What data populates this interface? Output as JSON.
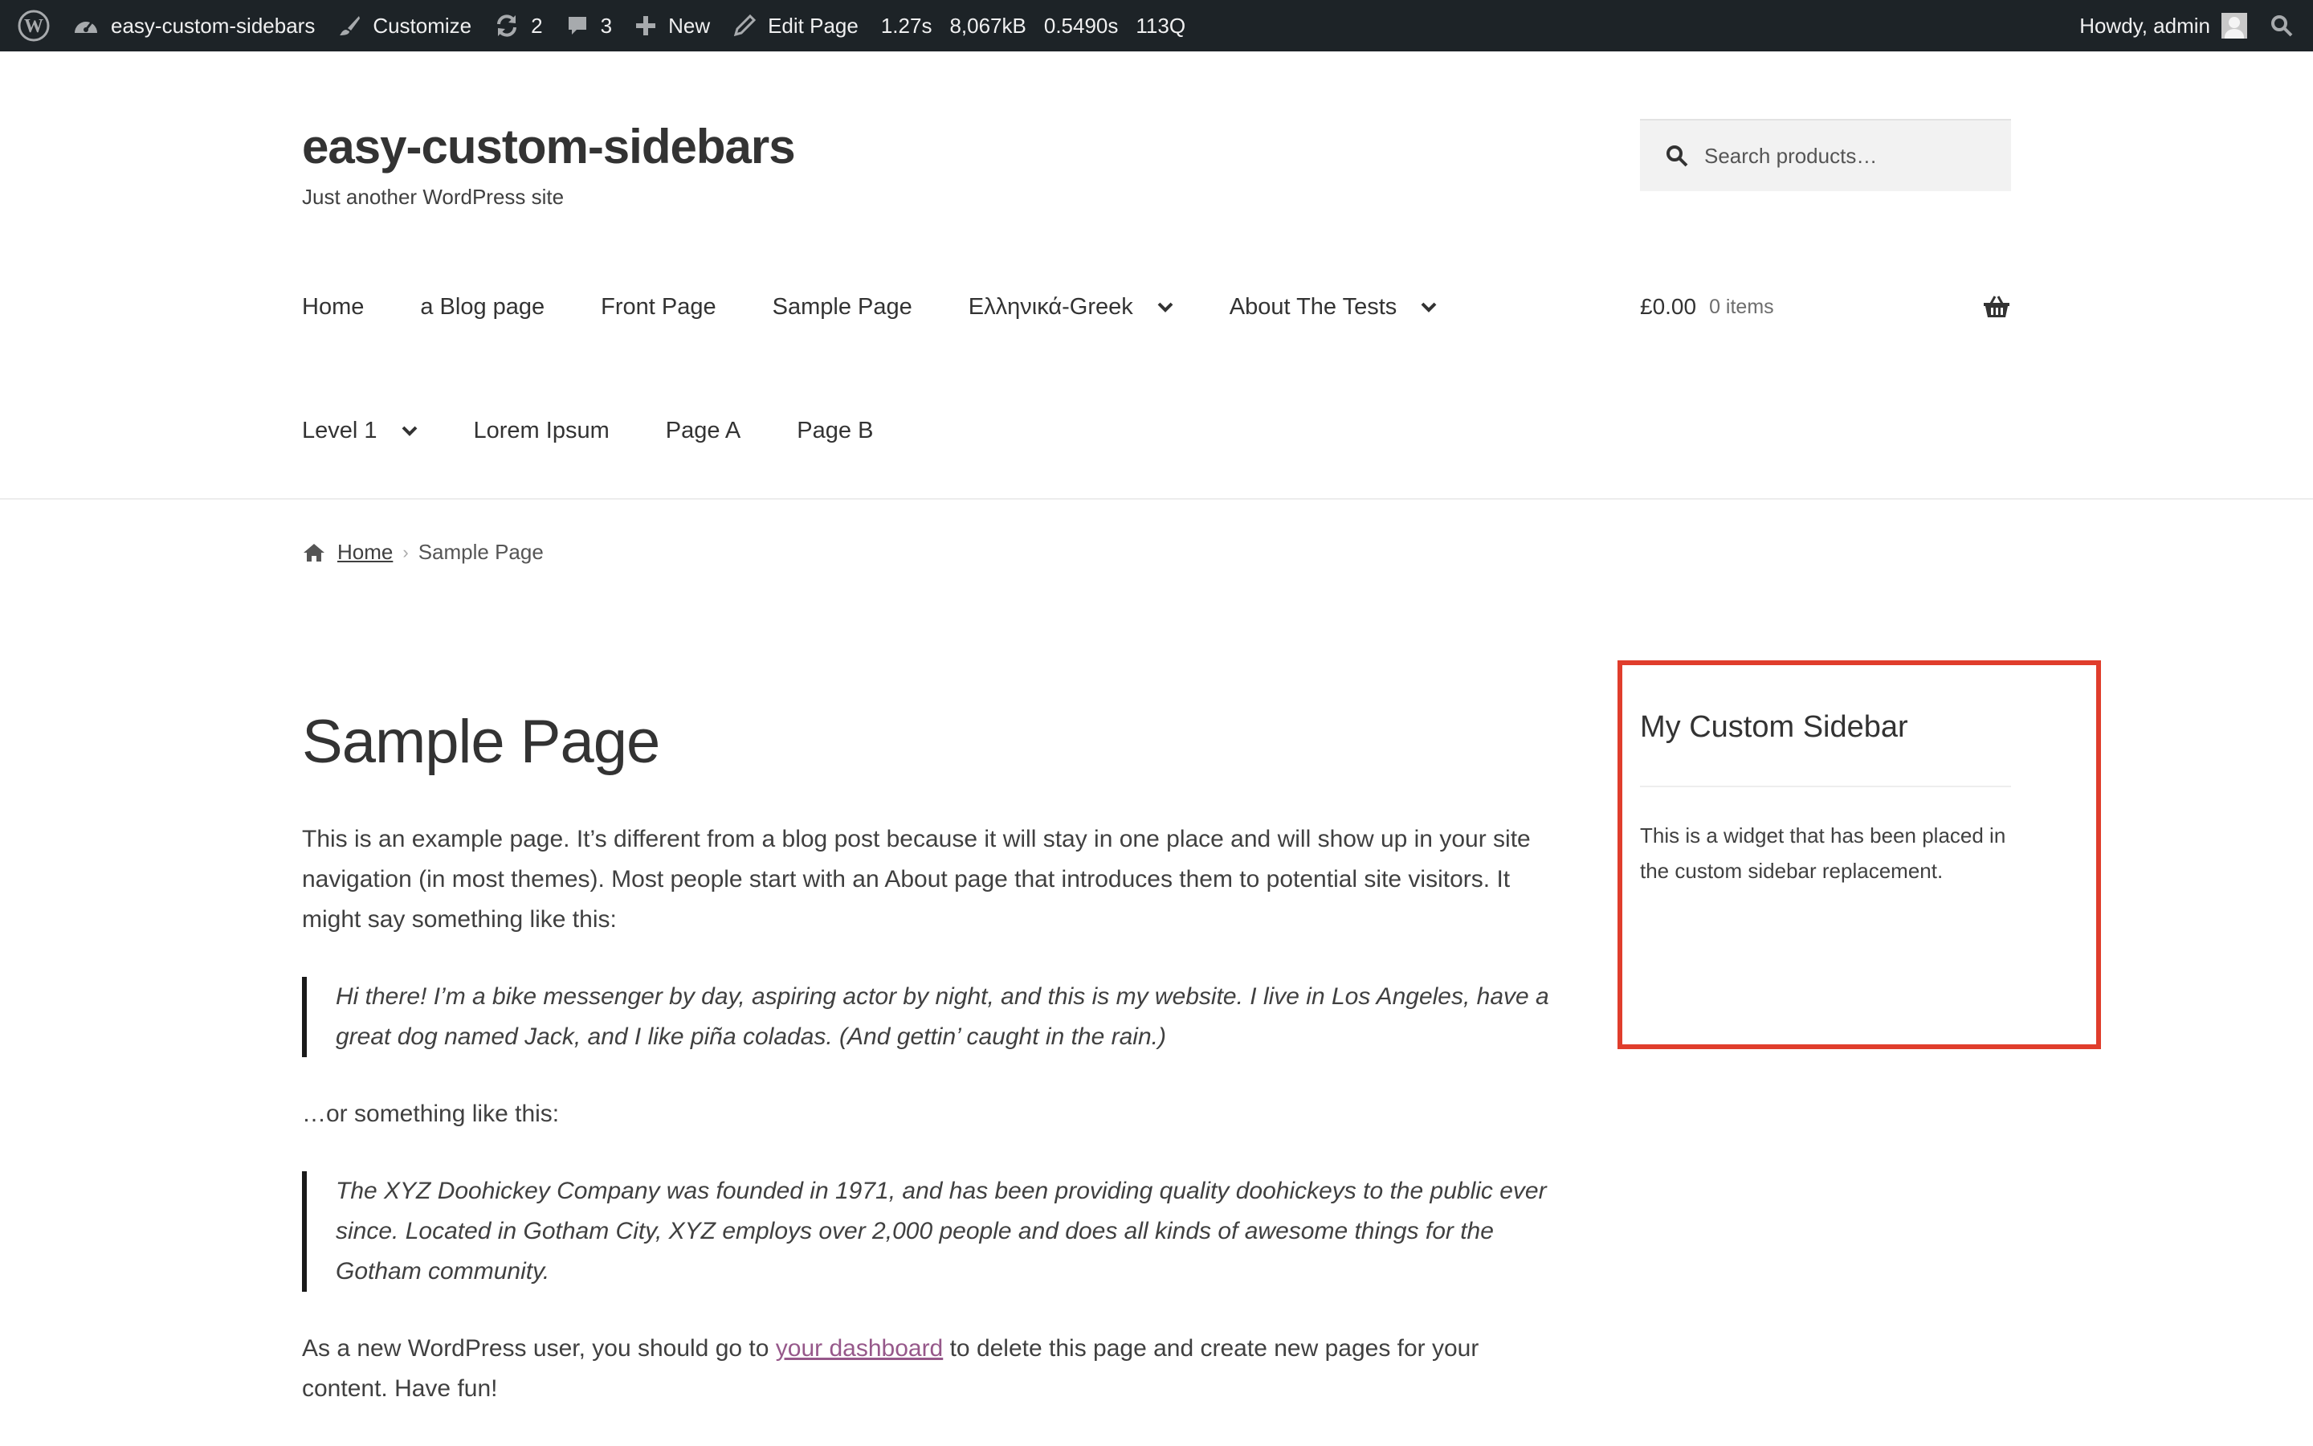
{
  "admin_bar": {
    "site_name": "easy-custom-sidebars",
    "customize": "Customize",
    "updates": "2",
    "comments": "3",
    "new": "New",
    "edit_page": "Edit Page",
    "stats": [
      "1.27s",
      "8,067kB",
      "0.5490s",
      "113Q"
    ],
    "howdy": "Howdy, admin"
  },
  "header": {
    "site_title": "easy-custom-sidebars",
    "tagline": "Just another WordPress site",
    "search_placeholder": "Search products…"
  },
  "nav": {
    "row1": [
      {
        "label": "Home",
        "has_children": false
      },
      {
        "label": "a Blog page",
        "has_children": false
      },
      {
        "label": "Front Page",
        "has_children": false
      },
      {
        "label": "Sample Page",
        "has_children": false
      },
      {
        "label": "Ελληνικά-Greek",
        "has_children": true
      },
      {
        "label": "About The Tests",
        "has_children": true
      }
    ],
    "row2": [
      {
        "label": "Level 1",
        "has_children": true
      },
      {
        "label": "Lorem Ipsum",
        "has_children": false
      },
      {
        "label": "Page A",
        "has_children": false
      },
      {
        "label": "Page B",
        "has_children": false
      }
    ]
  },
  "cart": {
    "amount": "£0.00",
    "count": "0 items"
  },
  "breadcrumb": {
    "home": "Home",
    "current": "Sample Page"
  },
  "content": {
    "title": "Sample Page",
    "p1": "This is an example page. It’s different from a blog post because it will stay in one place and will show up in your site navigation (in most themes). Most people start with an About page that introduces them to potential site visitors. It might say something like this:",
    "quote1": "Hi there! I’m a bike messenger by day, aspiring actor by night, and this is my website. I live in Los Angeles, have a great dog named Jack, and I like piña coladas. (And gettin’ caught in the rain.)",
    "p2": "…or something like this:",
    "quote2": "The XYZ Doohickey Company was founded in 1971, and has been providing quality doohickeys to the public ever since. Located in Gotham City, XYZ employs over 2,000 people and does all kinds of awesome things for the Gotham community.",
    "p3_before": "As a new WordPress user, you should go to ",
    "p3_link": "your dashboard",
    "p3_after": " to delete this page and create new pages for your content. Have fun!"
  },
  "sidebar": {
    "widget_title": "My Custom Sidebar",
    "widget_text": "This is a widget that has been placed in the custom sidebar replacement."
  },
  "colors": {
    "admin_bar_bg": "#1d2327",
    "highlight_border": "#e03d2c",
    "link_purple": "#96588a"
  }
}
